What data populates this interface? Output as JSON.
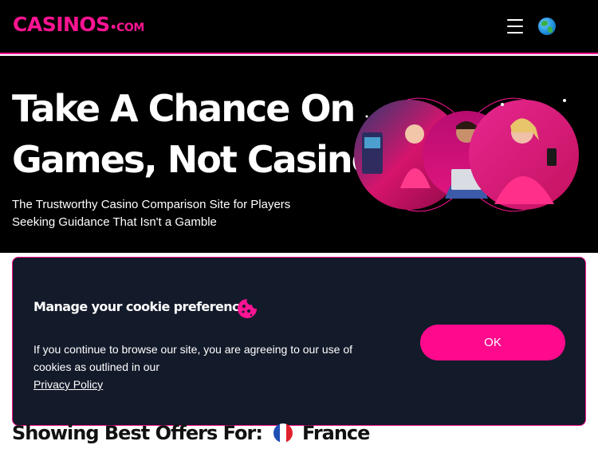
{
  "header": {
    "logo_main": "CASINOS",
    "logo_dot": "•",
    "logo_tld": "COM",
    "menu_icon": "hamburger-icon",
    "globe_icon": "globe-icon"
  },
  "hero": {
    "title_line1": "Take A Chance On",
    "title_line2": "Games, Not Casinos",
    "subtitle_line1": "The Trustworthy Casino Comparison Site for Players",
    "subtitle_line2": "Seeking Guidance That Isn't a Gamble"
  },
  "cookie": {
    "title": "Manage your cookie preference",
    "icon": "cookie-icon",
    "text_line1": "If you continue to browse our site, you are agreeing to our use of",
    "text_line2": "cookies as outlined in our",
    "link": "Privacy Policy",
    "ok_label": "OK"
  },
  "offers": {
    "label": "Showing Best Offers For:",
    "country": "France",
    "flag_icon": "france-flag-icon"
  },
  "colors": {
    "accent": "#ff1493",
    "button": "#ff0a8c",
    "panel": "#131a2a",
    "background": "#000000"
  }
}
